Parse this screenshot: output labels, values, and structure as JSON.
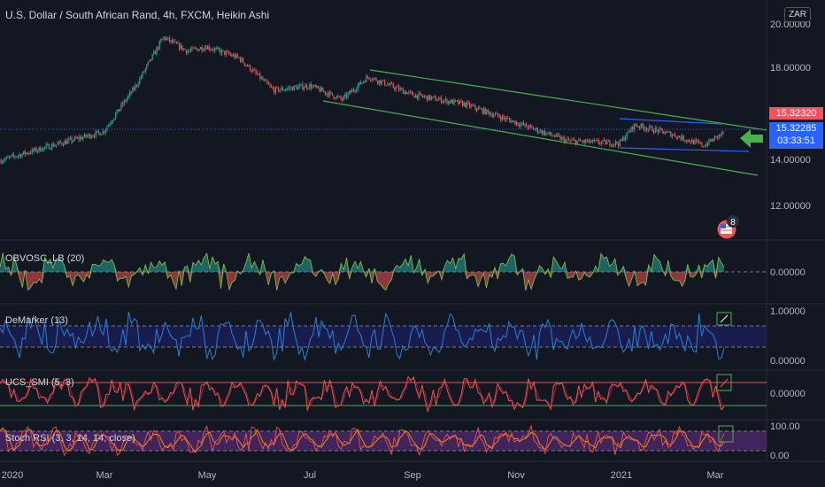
{
  "title": "U.S. Dollar / South African Rand, 4h, FXCM, Heikin Ashi",
  "currency": "ZAR",
  "price_tags": {
    "red": "15.32320",
    "blue": "15.32285",
    "countdown": "03:33:51"
  },
  "event_badge": "8",
  "colors": {
    "bg": "#131722",
    "up": "#26a69a",
    "down": "#ef5350",
    "channel": "#4caf50",
    "wedge": "#2962ff",
    "blue_line": "#2c7fd8",
    "red_line": "#ef5350",
    "purple_band": "#7b1fa2"
  },
  "chart_data": [
    {
      "type": "candlestick",
      "title": "U.S. Dollar / South African Rand, 4h, FXCM, Heikin Ashi",
      "x_ticks": [
        "2020",
        "Mar",
        "May",
        "Jul",
        "Sep",
        "Nov",
        "2021",
        "Mar"
      ],
      "y_ticks": [
        "12.00000",
        "14.00000",
        "18.00000"
      ],
      "y_top_label_partial": "20.00000",
      "ylim": [
        11.0,
        20.8
      ],
      "approx_close_path": [
        {
          "x": "2020-01",
          "y": 13.95
        },
        {
          "x": "2020-02",
          "y": 14.6
        },
        {
          "x": "2020-03",
          "y": 15.2
        },
        {
          "x": "2020-03-20",
          "y": 17.2
        },
        {
          "x": "2020-04-06",
          "y": 19.3
        },
        {
          "x": "2020-04-20",
          "y": 18.7
        },
        {
          "x": "2020-05-01",
          "y": 18.9
        },
        {
          "x": "2020-05-20",
          "y": 18.4
        },
        {
          "x": "2020-06-10",
          "y": 17.0
        },
        {
          "x": "2020-07-01",
          "y": 17.2
        },
        {
          "x": "2020-07-20",
          "y": 16.6
        },
        {
          "x": "2020-08-05",
          "y": 17.6
        },
        {
          "x": "2020-09-01",
          "y": 16.8
        },
        {
          "x": "2020-10-01",
          "y": 16.4
        },
        {
          "x": "2020-11-01",
          "y": 15.6
        },
        {
          "x": "2020-12-01",
          "y": 14.8
        },
        {
          "x": "2021-01-01",
          "y": 14.7
        },
        {
          "x": "2021-01-10",
          "y": 15.5
        },
        {
          "x": "2021-02-01",
          "y": 15.1
        },
        {
          "x": "2021-02-20",
          "y": 14.6
        },
        {
          "x": "2021-03-05",
          "y": 15.32
        }
      ]
    },
    {
      "type": "line",
      "label": "OBVOSC_LB (20)",
      "y_ticks": [
        "0.00000"
      ],
      "style": "histogram-area green/red around zero"
    },
    {
      "type": "line",
      "label": "DeMarker (13)",
      "y_ticks": [
        "1.00000",
        "0.00000"
      ],
      "levels": [
        0.3,
        0.7
      ]
    },
    {
      "type": "line",
      "label": "UCS_SMI (5, 3)",
      "y_ticks": [
        "0.00000"
      ]
    },
    {
      "type": "line",
      "label": "Stoch RSI (3, 3, 14, 14, close)",
      "y_ticks": [
        "100.00",
        "0.00"
      ],
      "levels": [
        20,
        80
      ]
    }
  ],
  "pane_labels": {
    "obv": "OBVOSC_LB (20)",
    "dem": "DeMarker (13)",
    "smi": "UCS_SMI (5, 3)",
    "stoch": "Stoch RSI (3, 3, 14, 14, close)"
  },
  "y_labels": {
    "price_top": "20.00000",
    "p18": "18.00000",
    "p14": "14.00000",
    "p12": "12.00000",
    "obv0": "0.00000",
    "dem1": "1.00000",
    "dem0": "0.00000",
    "smi0": "0.00000",
    "st100": "100.00",
    "st0": "0.00"
  },
  "x_labels": [
    "2020",
    "Mar",
    "May",
    "Jul",
    "Sep",
    "Nov",
    "2021",
    "Mar"
  ]
}
